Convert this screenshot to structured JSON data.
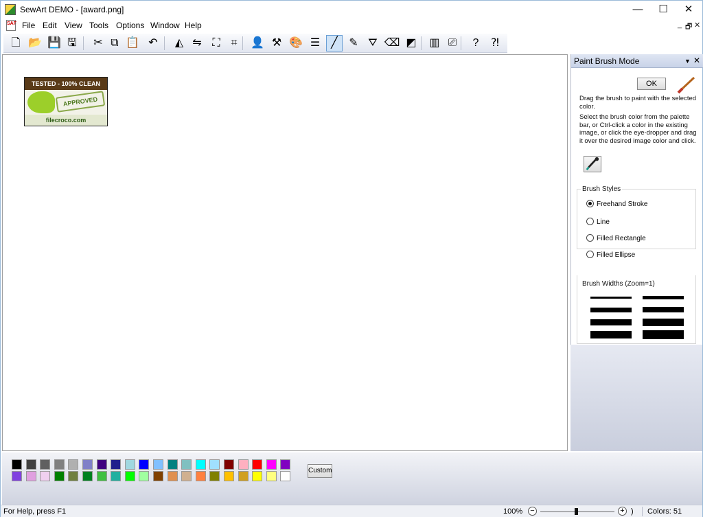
{
  "window": {
    "title": "SewArt DEMO - [award.png]",
    "minimize": "—",
    "maximize": "☐",
    "close": "✕"
  },
  "menu": {
    "items": [
      "File",
      "Edit",
      "View",
      "Tools",
      "Options",
      "Window",
      "Help"
    ],
    "doc_icon_text": "SAF",
    "mdi_minimize": "_",
    "mdi_restore": "🗗",
    "mdi_close": "✕"
  },
  "toolbar": {
    "buttons": [
      {
        "name": "new-icon",
        "glyph": "🗋"
      },
      {
        "name": "open-icon",
        "glyph": "📂"
      },
      {
        "name": "save-icon",
        "glyph": "💾"
      },
      {
        "name": "save-as-icon",
        "glyph": "🖫"
      },
      {
        "name": "cut-icon",
        "glyph": "✂"
      },
      {
        "name": "copy-icon",
        "glyph": "⧉"
      },
      {
        "name": "paste-icon",
        "glyph": "📋"
      },
      {
        "name": "undo-icon",
        "glyph": "↶"
      },
      {
        "name": "flip-icon",
        "glyph": "◭"
      },
      {
        "name": "mirror-icon",
        "glyph": "⇋"
      },
      {
        "name": "resize-icon",
        "glyph": "⛶"
      },
      {
        "name": "crop-icon",
        "glyph": "⌗"
      },
      {
        "name": "user-icon",
        "glyph": "👤"
      },
      {
        "name": "tools-icon",
        "glyph": "⚒"
      },
      {
        "name": "palette-icon",
        "glyph": "🎨"
      },
      {
        "name": "colors-list-icon",
        "glyph": "☰"
      },
      {
        "name": "paint-brush-icon",
        "glyph": "╱"
      },
      {
        "name": "pencil-icon",
        "glyph": "✎"
      },
      {
        "name": "fill-bucket-icon",
        "glyph": "⛛"
      },
      {
        "name": "eraser-icon",
        "glyph": "⌫"
      },
      {
        "name": "color-replace-icon",
        "glyph": "◩"
      },
      {
        "name": "stitch-preview-icon",
        "glyph": "▥"
      },
      {
        "name": "sew-icon",
        "glyph": "⎚"
      },
      {
        "name": "help-icon",
        "glyph": "?"
      },
      {
        "name": "context-help-icon",
        "glyph": "⁈"
      }
    ],
    "active_index": 16
  },
  "panel": {
    "title": "Paint Brush Mode",
    "dropdown_glyph": "▼",
    "close_glyph": "✕",
    "ok_label": "OK",
    "desc1": "Drag the brush to paint with the selected color.",
    "desc2": "Select the brush color from the palette bar, or Ctrl-click a color in the existing image, or click the eye-dropper and drag it over the desired image color and click.",
    "brush_styles_title": "Brush Styles",
    "styles": [
      "Freehand Stroke",
      "Line",
      "Filled Rectangle",
      "Filled Ellipse"
    ],
    "selected_style": 0,
    "brush_widths_title": "Brush Widths (Zoom=1)"
  },
  "image": {
    "banner": "TESTED - 100% CLEAN",
    "stamp": "APPROVED",
    "footer": "filecroco.com"
  },
  "palette": {
    "row1": [
      "#000000",
      "#404040",
      "#606060",
      "#808080",
      "#b0b0b0",
      "#8080c8",
      "#400080",
      "#20208c",
      "#a0d8e0",
      "#0000ff",
      "#80c0ff",
      "#008080",
      "#80c0c0",
      "#00ffff",
      "#a0e0ff",
      "#800000",
      "#ffb0c0",
      "#ff0000",
      "#ff00ff",
      "#8000c0"
    ],
    "row2": [
      "#8040e0",
      "#e0a0e0",
      "#f0d0f0",
      "#008000",
      "#708040",
      "#008020",
      "#40c040",
      "#20b0a0",
      "#00ff00",
      "#a0ffa0",
      "#804000",
      "#e09050",
      "#d0b090",
      "#ff8040",
      "#808000",
      "#ffc000",
      "#d0a020",
      "#ffff00",
      "#ffff80",
      "#ffffff"
    ],
    "custom_label": "Custom"
  },
  "status": {
    "help_text": "For Help, press F1",
    "zoom": "100%",
    "zoom_tail": ")",
    "colors": "Colors: 51"
  }
}
